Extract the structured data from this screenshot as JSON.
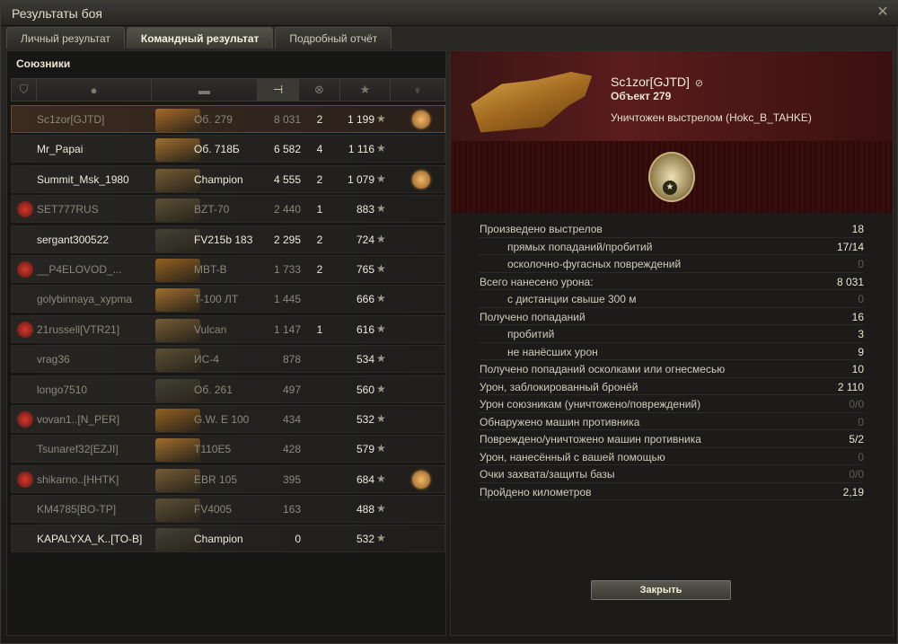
{
  "window": {
    "title": "Результаты боя",
    "close_glyph": "✕"
  },
  "tabs": [
    {
      "label": "Личный результат"
    },
    {
      "label": "Командный результат"
    },
    {
      "label": "Подробный отчёт"
    }
  ],
  "allies": {
    "title": "Союзники",
    "column_icons": [
      "rank-icon",
      "player-icon",
      "tank-icon",
      "damage-sort-icon",
      "kills-icon",
      "xp-star-icon",
      "medal-icon"
    ],
    "rows": [
      {
        "name": "Sc1zor[GJTD]",
        "tank": "Об. 279",
        "damage": "8 031",
        "kills": "2",
        "xp": "1 199",
        "medal": true,
        "me": true,
        "dim": true
      },
      {
        "name": "Mr_Papai",
        "tank": "Об. 718Б",
        "damage": "6 582",
        "kills": "4",
        "xp": "1 116",
        "medal": false
      },
      {
        "name": "Summit_Msk_1980",
        "tank": "Champion",
        "damage": "4 555",
        "kills": "2",
        "xp": "1 079",
        "medal": true
      },
      {
        "name": "SET777RUS",
        "tank": "BZT-70",
        "damage": "2 440",
        "kills": "1",
        "xp": "883",
        "medal": false,
        "emblem": true,
        "dim": true
      },
      {
        "name": "sergant300522",
        "tank": "FV215b 183",
        "damage": "2 295",
        "kills": "2",
        "xp": "724",
        "medal": false
      },
      {
        "name": "__P4ELOVOD_...",
        "tank": "MBT-B",
        "damage": "1 733",
        "kills": "2",
        "xp": "765",
        "medal": false,
        "emblem": true,
        "dim": true
      },
      {
        "name": "golybinnaya_xypma",
        "tank": "T-100 ЛТ",
        "damage": "1 445",
        "kills": "",
        "xp": "666",
        "medal": false,
        "dim": true
      },
      {
        "name": "21russell[VTR21]",
        "tank": "Vulcan",
        "damage": "1 147",
        "kills": "1",
        "xp": "616",
        "medal": false,
        "emblem": true,
        "dim": true
      },
      {
        "name": "vrag36",
        "tank": "ИС-4",
        "damage": "878",
        "kills": "",
        "xp": "534",
        "medal": false,
        "dim": true
      },
      {
        "name": "longo7510",
        "tank": "Об. 261",
        "damage": "497",
        "kills": "",
        "xp": "560",
        "medal": false,
        "dim": true
      },
      {
        "name": "vovan1..[N_PER]",
        "tank": "G.W. E 100",
        "damage": "434",
        "kills": "",
        "xp": "532",
        "medal": false,
        "emblem": true,
        "dim": true
      },
      {
        "name": "Tsunaref32[EZJI]",
        "tank": "T110E5",
        "damage": "428",
        "kills": "",
        "xp": "579",
        "medal": false,
        "dim": true
      },
      {
        "name": "shikarno..[HHTK]",
        "tank": "EBR 105",
        "damage": "395",
        "kills": "",
        "xp": "684",
        "medal": true,
        "emblem": true,
        "dim": true
      },
      {
        "name": "KM4785[BO-TP]",
        "tank": "FV4005",
        "damage": "163",
        "kills": "",
        "xp": "488",
        "medal": false,
        "dim": true
      },
      {
        "name": "KAPALYXA_K..[TO-B]",
        "tank": "Champion",
        "damage": "0",
        "kills": "",
        "xp": "532",
        "medal": false
      }
    ]
  },
  "player": {
    "nick": "Sc1zor[GJTD]",
    "tank": "Объект 279",
    "killed_by": "Уничтожен выстрелом (Hokc_B_TAHKE)"
  },
  "stats": [
    {
      "label": "Произведено выстрелов",
      "value": "18",
      "sub": false,
      "dim": false
    },
    {
      "label": "прямых попаданий/пробитий",
      "value": "17/14",
      "sub": true,
      "dim": false
    },
    {
      "label": "осколочно-фугасных повреждений",
      "value": "0",
      "sub": true,
      "dim": true
    },
    {
      "label": "Всего нанесено урона:",
      "value": "8 031",
      "sub": false,
      "dim": false
    },
    {
      "label": "с дистанции свыше 300 м",
      "value": "0",
      "sub": true,
      "dim": true
    },
    {
      "label": "Получено попаданий",
      "value": "16",
      "sub": false,
      "dim": false
    },
    {
      "label": "пробитий",
      "value": "3",
      "sub": true,
      "dim": false
    },
    {
      "label": "не нанёсших урон",
      "value": "9",
      "sub": true,
      "dim": false
    },
    {
      "label": "Получено попаданий осколками или огнесмесью",
      "value": "10",
      "sub": false,
      "dim": false
    },
    {
      "label": "Урон, заблокированный бронёй",
      "value": "2 110",
      "sub": false,
      "dim": false
    },
    {
      "label": "Урон союзникам (уничтожено/повреждений)",
      "value": "0/0",
      "sub": false,
      "dim": true
    },
    {
      "label": "Обнаружено машин противника",
      "value": "0",
      "sub": false,
      "dim": true
    },
    {
      "label": "Повреждено/уничтожено машин противника",
      "value": "5/2",
      "sub": false,
      "dim": false
    },
    {
      "label": "Урон, нанесённый с вашей помощью",
      "value": "0",
      "sub": false,
      "dim": true
    },
    {
      "label": "Очки захвата/защиты базы",
      "value": "0/0",
      "sub": false,
      "dim": true
    },
    {
      "label": "Пройдено километров",
      "value": "2,19",
      "sub": false,
      "dim": false
    }
  ],
  "close_button": {
    "label": "Закрыть"
  },
  "colors": {
    "accent": "#ffb36a",
    "header_red": "#5a1c1c"
  }
}
